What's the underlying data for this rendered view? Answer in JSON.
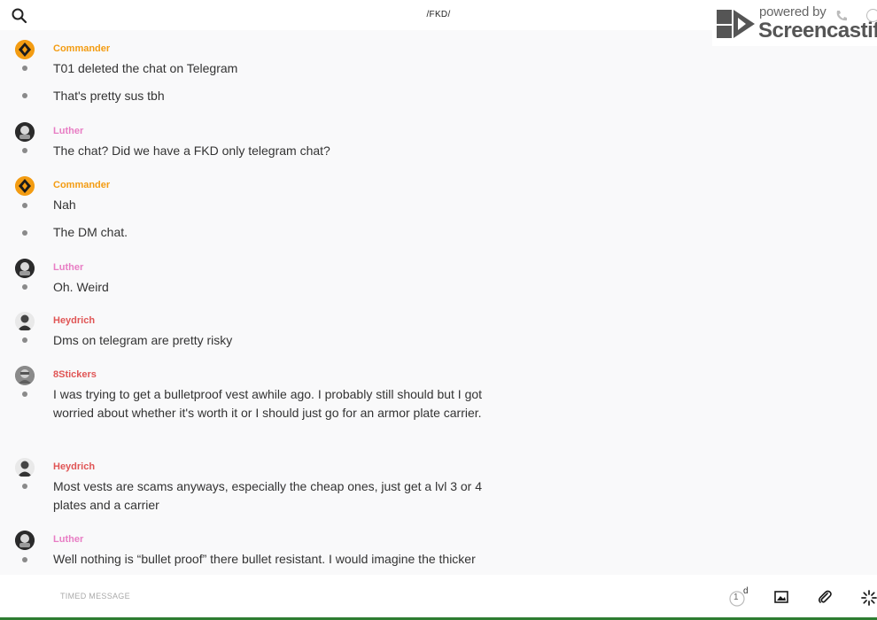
{
  "header": {
    "channel": "/FKD/"
  },
  "watermark": {
    "powered_by": "powered by",
    "brand": "Screencastify"
  },
  "colors": {
    "commander": "#f39c12",
    "luther": "#e87dc4",
    "heydrich": "#e05555",
    "8stickers": "#e05555"
  },
  "messages": [
    {
      "author": "Commander",
      "avatar": "commander-avatar-icon",
      "lines": [
        "T01 deleted the chat on Telegram",
        "That's pretty sus tbh"
      ]
    },
    {
      "author": "Luther",
      "avatar": "luther-avatar-icon",
      "lines": [
        "The chat? Did we have a FKD only telegram chat?"
      ]
    },
    {
      "author": "Commander",
      "avatar": "commander-avatar-icon",
      "lines": [
        "Nah",
        "The DM chat."
      ]
    },
    {
      "author": "Luther",
      "avatar": "luther-avatar-icon",
      "lines": [
        "Oh. Weird"
      ]
    },
    {
      "author": "Heydrich",
      "avatar": "heydrich-avatar-icon",
      "lines": [
        "Dms on telegram are pretty risky"
      ]
    },
    {
      "author": "8Stickers",
      "avatar": "8stickers-avatar-icon",
      "lines": [
        "I was trying to get a bulletproof vest awhile ago. I probably still should but I got worried about whether it's worth it or I should just go for an armor plate carrier."
      ]
    },
    {
      "author": "Heydrich",
      "avatar": "heydrich-avatar-icon",
      "lines": [
        "Most vests are scams anyways, especially the cheap ones, just get a lvl 3 or 4 plates and a carrier"
      ]
    },
    {
      "author": "Luther",
      "avatar": "luther-avatar-icon",
      "lines": [
        "Well nothing is “bullet proof” there bullet resistant. I would imagine the thicker"
      ]
    }
  ],
  "composer": {
    "placeholder": "TIMED MESSAGE",
    "timer_value": "1",
    "timer_unit": "d"
  }
}
